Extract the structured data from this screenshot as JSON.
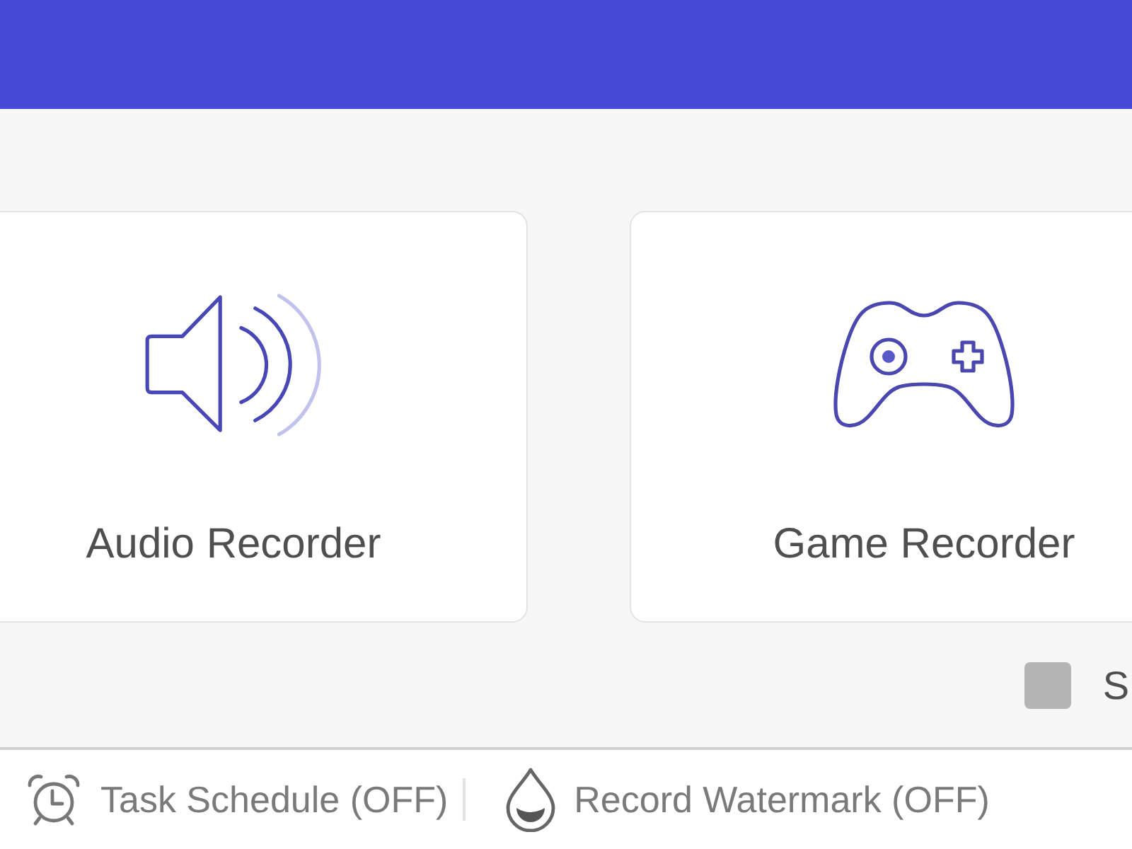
{
  "recorders": [
    {
      "kind": "audio",
      "label": "Audio Recorder"
    },
    {
      "kind": "game",
      "label": "Game Recorder"
    }
  ],
  "option": {
    "checked": false,
    "label": "S"
  },
  "footer": [
    {
      "kind": "schedule",
      "label": "Task Schedule (OFF)"
    },
    {
      "kind": "watermark",
      "label": "Record Watermark (OFF)"
    }
  ]
}
